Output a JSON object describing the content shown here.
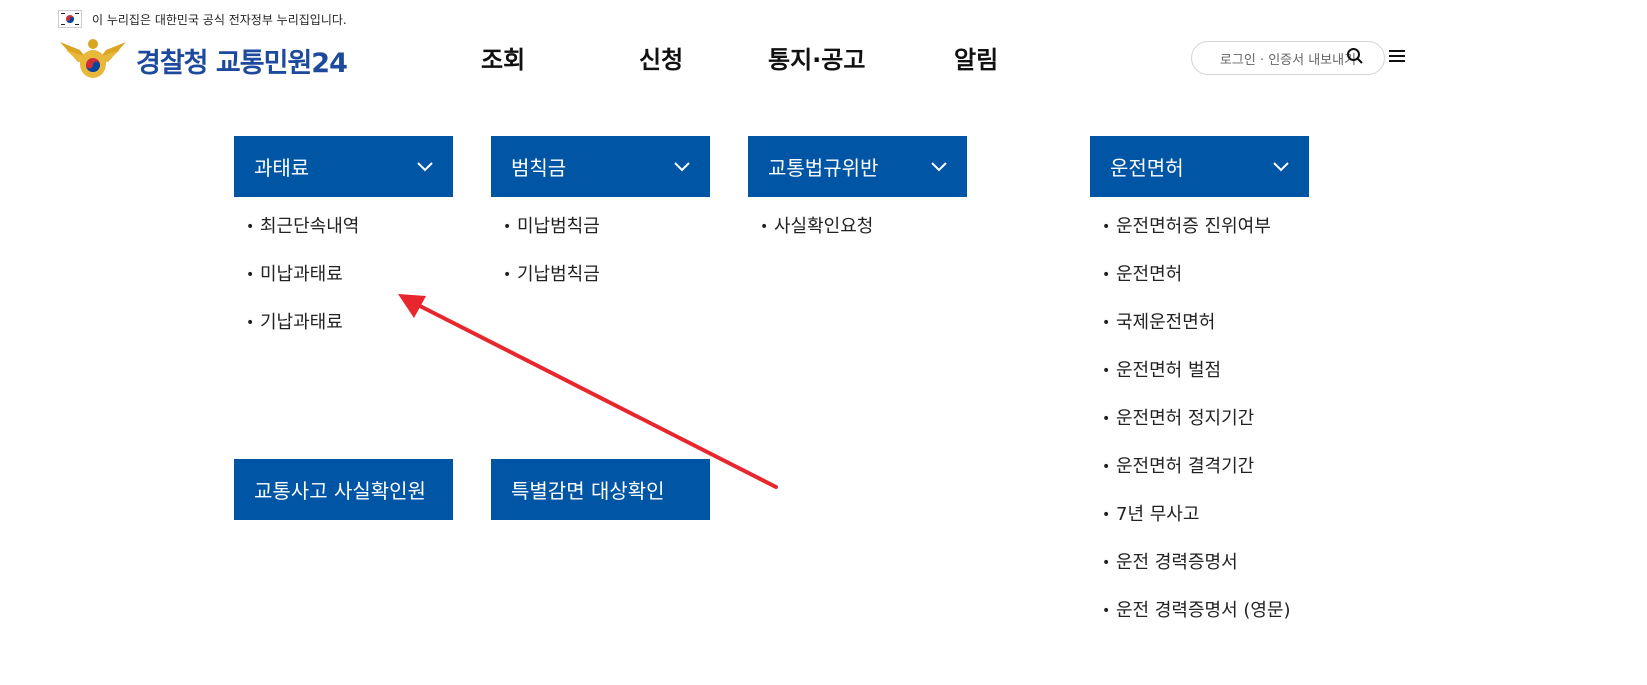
{
  "gov_banner": {
    "text": "이 누리집은 대한민국 공식 전자정부 누리집입니다.",
    "flag_icon": "korea-flag-icon"
  },
  "logo": {
    "text": "경찰청 교통민원24",
    "emblem_icon": "police-eagle-emblem-icon"
  },
  "gnb": [
    "조회",
    "신청",
    "통지·공고",
    "알림"
  ],
  "header_utils": {
    "login_label": "로그인 · 인증서 내보내기",
    "search_icon": "search-icon",
    "menu_icon": "menu-icon"
  },
  "categories": [
    {
      "title": "과태료",
      "items": [
        "최근단속내역",
        "미납과태료",
        "기납과태료"
      ]
    },
    {
      "title": "범칙금",
      "items": [
        "미납범칙금",
        "기납범칙금"
      ]
    },
    {
      "title": "교통법규위반",
      "items": [
        "사실확인요청"
      ]
    },
    {
      "title": "운전면허",
      "items": [
        "운전면허증 진위여부",
        "운전면허",
        "국제운전면허",
        "운전면허 벌점",
        "운전면허 정지기간",
        "운전면허 결격기간",
        "7년 무사고",
        "운전 경력증명서",
        "운전 경력증명서 (영문)"
      ]
    }
  ],
  "quick_links": [
    "교통사고 사실확인원",
    "특별감면 대상확인"
  ],
  "bullet": "•",
  "colors": {
    "brand_blue": "#0055a5",
    "logo_blue": "#1d4a9c",
    "annotation_red": "#e8262d"
  }
}
